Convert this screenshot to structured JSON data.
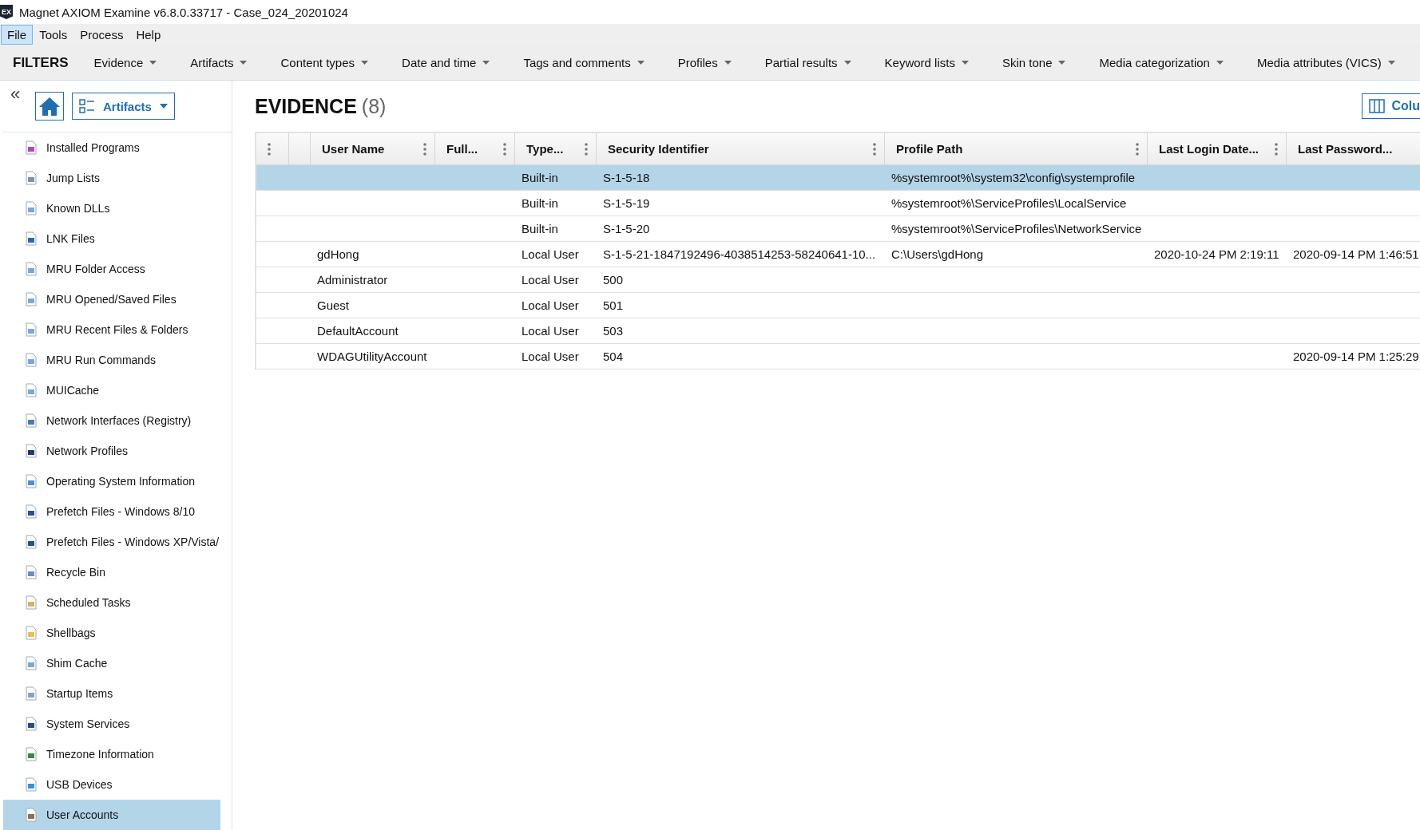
{
  "window": {
    "app_icon": "EX",
    "title": "Magnet AXIOM Examine v6.8.0.33717 - Case_024_20201024"
  },
  "menu": [
    {
      "label": "File",
      "selected": true
    },
    {
      "label": "Tools",
      "selected": false
    },
    {
      "label": "Process",
      "selected": false
    },
    {
      "label": "Help",
      "selected": false
    }
  ],
  "filters": {
    "title": "FILTERS",
    "items": [
      "Evidence",
      "Artifacts",
      "Content types",
      "Date and time",
      "Tags and comments",
      "Profiles",
      "Partial results",
      "Keyword lists",
      "Skin tone",
      "Media categorization",
      "Media attributes (VICS)"
    ]
  },
  "toolbar": {
    "collapse": "«",
    "view_button": "Artifacts",
    "columns_button": "Colu"
  },
  "heading": {
    "title": "EVIDENCE",
    "count": "(8)"
  },
  "sidebar": {
    "items": [
      {
        "label": "Installed Programs",
        "selected": false
      },
      {
        "label": "Jump Lists",
        "selected": false
      },
      {
        "label": "Known DLLs",
        "selected": false
      },
      {
        "label": "LNK Files",
        "selected": false
      },
      {
        "label": "MRU Folder Access",
        "selected": false
      },
      {
        "label": "MRU Opened/Saved Files",
        "selected": false
      },
      {
        "label": "MRU Recent Files & Folders",
        "selected": false
      },
      {
        "label": "MRU Run Commands",
        "selected": false
      },
      {
        "label": "MUICache",
        "selected": false
      },
      {
        "label": "Network Interfaces (Registry)",
        "selected": false
      },
      {
        "label": "Network Profiles",
        "selected": false
      },
      {
        "label": "Operating System Information",
        "selected": false
      },
      {
        "label": "Prefetch Files - Windows 8/10",
        "selected": false
      },
      {
        "label": "Prefetch Files - Windows XP/Vista/",
        "selected": false
      },
      {
        "label": "Recycle Bin",
        "selected": false
      },
      {
        "label": "Scheduled Tasks",
        "selected": false
      },
      {
        "label": "Shellbags",
        "selected": false
      },
      {
        "label": "Shim Cache",
        "selected": false
      },
      {
        "label": "Startup Items",
        "selected": false
      },
      {
        "label": "System Services",
        "selected": false
      },
      {
        "label": "Timezone Information",
        "selected": false
      },
      {
        "label": "USB Devices",
        "selected": false
      },
      {
        "label": "User Accounts",
        "selected": true
      }
    ]
  },
  "table": {
    "columns": [
      "User Name",
      "Full...",
      "Type...",
      "Security Identifier",
      "Profile Path",
      "Last Login Date...",
      "Last Password..."
    ],
    "rows": [
      {
        "selected": true,
        "type": "Built-in",
        "sid": "S-1-5-18",
        "profile_path": "%systemroot%\\system32\\config\\systemprofile"
      },
      {
        "selected": false,
        "type": "Built-in",
        "sid": "S-1-5-19",
        "profile_path": "%systemroot%\\ServiceProfiles\\LocalService"
      },
      {
        "selected": false,
        "type": "Built-in",
        "sid": "S-1-5-20",
        "profile_path": "%systemroot%\\ServiceProfiles\\NetworkService"
      },
      {
        "selected": false,
        "user_name": "gdHong",
        "type": "Local User",
        "sid": "S-1-5-21-1847192496-4038514253-58240641-10...",
        "profile_path": "C:\\Users\\gdHong",
        "last_login": "2020-10-24 PM 2:19:11",
        "last_password": "2020-09-14 PM 1:46:51"
      },
      {
        "selected": false,
        "user_name": "Administrator",
        "type": "Local User",
        "sid": "500"
      },
      {
        "selected": false,
        "user_name": "Guest",
        "type": "Local User",
        "sid": "501"
      },
      {
        "selected": false,
        "user_name": "DefaultAccount",
        "type": "Local User",
        "sid": "503"
      },
      {
        "selected": false,
        "user_name": "WDAGUtilityAccount",
        "type": "Local User",
        "sid": "504",
        "last_password": "2020-09-14 PM 1:25:29"
      }
    ]
  }
}
